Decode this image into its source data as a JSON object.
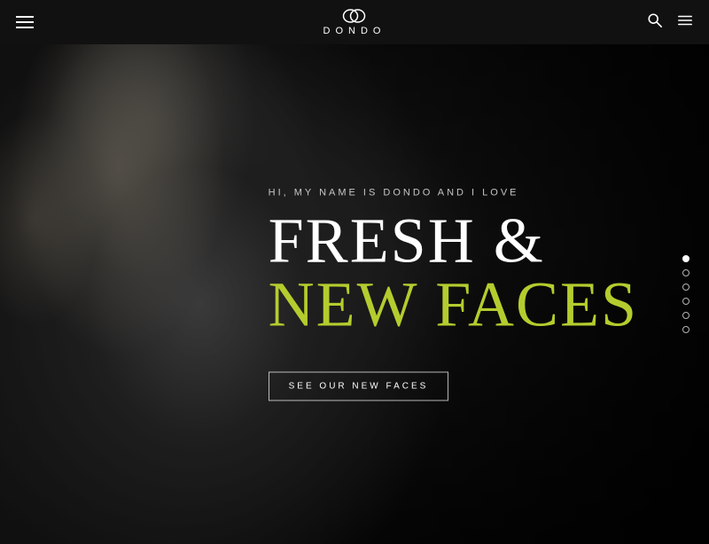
{
  "header": {
    "logo_text": "DONDO",
    "nav_left_label": "menu-open",
    "search_label": "search",
    "menu_right_label": "menu-right"
  },
  "hero": {
    "subtitle": "HI, MY NAME IS DONDO AND I LOVE",
    "title_line1": "FRESH &",
    "title_line2": "NEW FACES",
    "cta_button_label": "SEE OUR NEW FACES"
  },
  "pagination": {
    "dots": [
      {
        "id": 1,
        "active": true
      },
      {
        "id": 2,
        "active": false
      },
      {
        "id": 3,
        "active": false
      },
      {
        "id": 4,
        "active": false
      },
      {
        "id": 5,
        "active": false
      },
      {
        "id": 6,
        "active": false
      }
    ]
  },
  "colors": {
    "accent_green": "#b5cc2e",
    "header_bg": "#111111",
    "hero_bg": "#1a1a1a"
  }
}
